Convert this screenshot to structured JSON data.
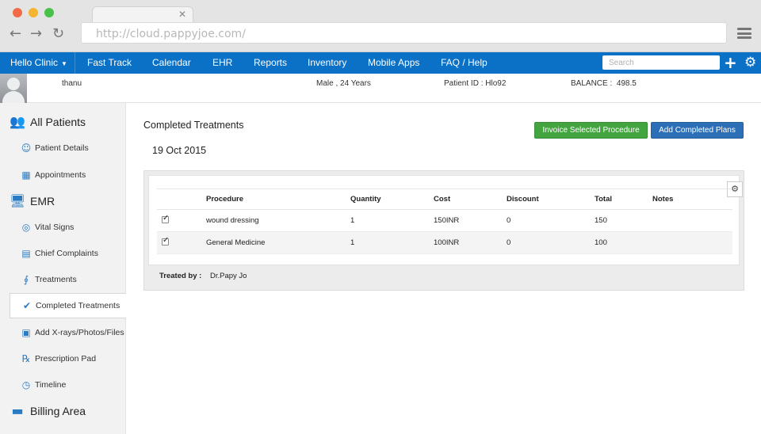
{
  "browser": {
    "url": "http://cloud.pappyjoe.com/"
  },
  "nav": {
    "brand": "Hello Clinic",
    "items": [
      "Fast Track",
      "Calendar",
      "EHR",
      "Reports",
      "Inventory",
      "Mobile Apps",
      "FAQ / Help"
    ],
    "search_placeholder": "Search"
  },
  "patient": {
    "name": "thanu",
    "gender_age": "Male , 24 Years",
    "id_label": "Patient ID :",
    "id_value": "Hlo92",
    "balance_label": "BALANCE :",
    "balance_value": "498.5"
  },
  "sidebar": {
    "all_patients": "All Patients",
    "patient_details": "Patient Details",
    "appointments": "Appointments",
    "emr": "EMR",
    "vital_signs": "Vital Signs",
    "chief_complaints": "Chief Complaints",
    "treatments": "Treatments",
    "completed_treatments": "Completed Treatments",
    "add_files": "Add X-rays/Photos/Files",
    "prescription_pad": "Prescription Pad",
    "timeline": "Timeline",
    "billing_area": "Billing Area"
  },
  "main": {
    "title": "Completed Treatments",
    "date": "19 Oct 2015",
    "invoice_button": "Invoice Selected Procedure",
    "add_button": "Add Completed Plans",
    "columns": [
      "Procedure",
      "Quantity",
      "Cost",
      "Discount",
      "Total",
      "Notes"
    ],
    "rows": [
      {
        "procedure": "wound dressing",
        "quantity": "1",
        "cost": "150INR",
        "discount": "0",
        "total": "150",
        "notes": ""
      },
      {
        "procedure": "General Medicine",
        "quantity": "1",
        "cost": "100INR",
        "discount": "0",
        "total": "100",
        "notes": ""
      }
    ],
    "treated_by_label": "Treated by :",
    "treated_by_value": "Dr.Papy Jo"
  },
  "colors": {
    "nav_blue": "#0b71c7",
    "green_button": "#44a540",
    "blue_button": "#2c6fb6",
    "icon_blue": "#2b7bc4"
  },
  "icons": {
    "back": "arrow-left-icon",
    "forward": "arrow-right-icon",
    "reload": "reload-icon",
    "menu": "hamburger-icon",
    "add": "plus-icon",
    "settings": "gear-icon",
    "table_settings": "gears-icon"
  }
}
